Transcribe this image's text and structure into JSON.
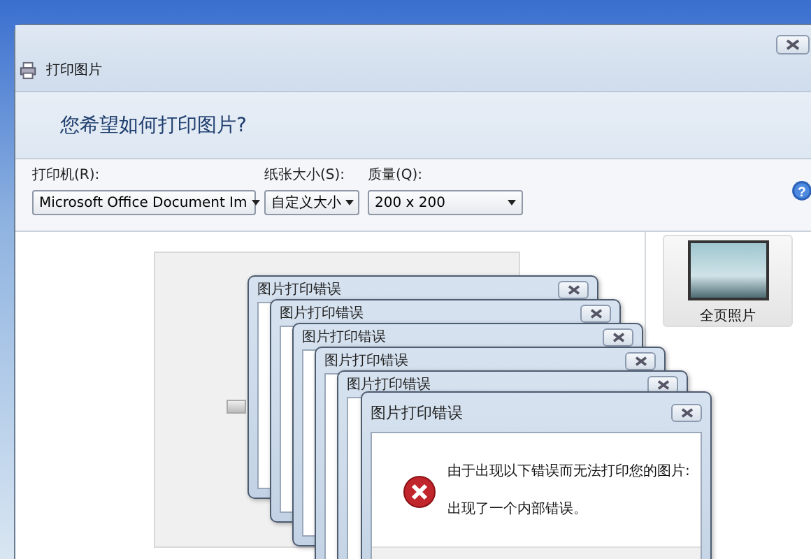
{
  "window": {
    "title": "打印图片"
  },
  "header": {
    "question": "您希望如何打印图片?"
  },
  "options": [
    {
      "label": "打印机(R):",
      "value": "Microsoft Office Document Im"
    },
    {
      "label": "纸张大小(S):",
      "value": "自定义大小"
    },
    {
      "label": "质量(Q):",
      "value": "200 x 200"
    }
  ],
  "help": {
    "label": "?"
  },
  "layouts": [
    {
      "label": "全页照片",
      "selected": true
    }
  ],
  "error_dialogs": [
    {
      "title": "图片打印错误"
    },
    {
      "title": "图片打印错误"
    },
    {
      "title": "图片打印错误"
    },
    {
      "title": "图片打印错误"
    },
    {
      "title": "图片打印错误"
    },
    {
      "title": "图片打印错误",
      "messages": [
        "由于出现以下错误而无法打印您的图片:",
        "出现了一个内部错误。"
      ]
    }
  ]
}
